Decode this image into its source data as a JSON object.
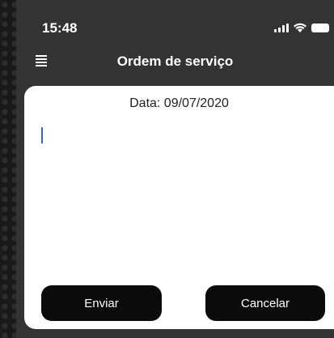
{
  "status": {
    "time": "15:48"
  },
  "header": {
    "title": "Ordem de serviço",
    "menu_icon": "hamburger-menu-icon"
  },
  "form": {
    "date_label": "Data: 09/07/2020",
    "text_value": ""
  },
  "actions": {
    "send_label": "Enviar",
    "cancel_label": "Cancelar"
  },
  "colors": {
    "background": "#333333",
    "card": "#ffffff",
    "button": "#0b0b0b",
    "cursor": "#3b5fd1"
  }
}
